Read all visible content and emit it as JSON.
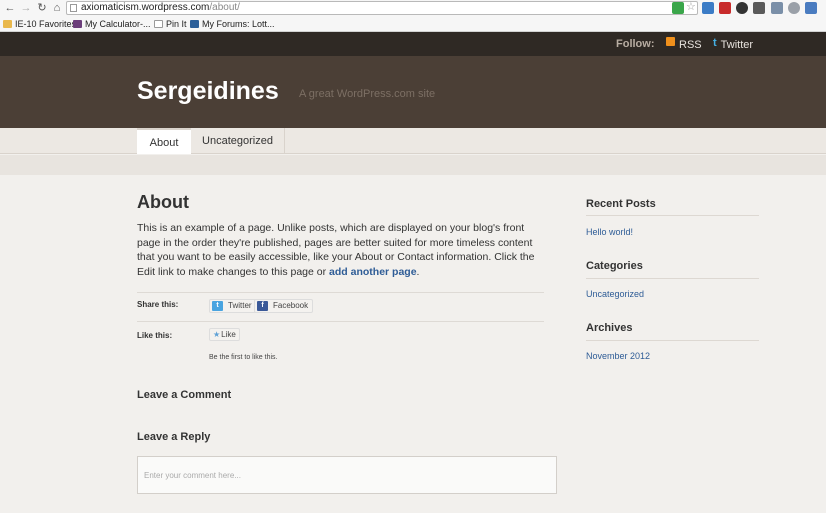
{
  "browser": {
    "url_domain": "axiomaticism.wordpress.com",
    "url_path": "/about/",
    "bookmarks": [
      {
        "label": "IE-10 Favorites",
        "icon": "folder-icon",
        "color": "#e9b84c"
      },
      {
        "label": "My Calculator-...",
        "icon": "calculator-icon",
        "color": "#6b3d7a"
      },
      {
        "label": "Pin It",
        "icon": "page-icon",
        "color": "#ffffff"
      },
      {
        "label": "My Forums: Lott...",
        "icon": "forum-icon",
        "color": "#2c5f99"
      }
    ]
  },
  "header": {
    "follow_label": "Follow:",
    "rss_label": "RSS",
    "twitter_label": "Twitter",
    "site_title": "Sergeidines",
    "tagline": "A great WordPress.com site"
  },
  "menu": {
    "items": [
      {
        "label": "About",
        "active": true
      },
      {
        "label": "Uncategorized",
        "active": false
      }
    ]
  },
  "post": {
    "title": "About",
    "body_text": "This is an example of a page. Unlike posts, which are displayed on your blog's front page in the order they're published, pages are better suited for more timeless content that you want to be easily accessible, like your About or Contact information. Click the Edit link to make changes to this page or ",
    "body_link": "add another page",
    "body_end": ".",
    "share_label": "Share this:",
    "share_twitter": "Twitter",
    "share_facebook": "Facebook",
    "like_label": "Like this:",
    "like_button": "Like",
    "first_like": "Be the first to like this.",
    "leave_comment": "Leave a Comment",
    "leave_reply": "Leave a Reply",
    "comment_placeholder": "Enter your comment here..."
  },
  "sidebar": {
    "recent_posts_title": "Recent Posts",
    "recent_posts": [
      "Hello world!"
    ],
    "categories_title": "Categories",
    "categories": [
      "Uncategorized"
    ],
    "archives_title": "Archives",
    "archives": [
      "November 2012"
    ]
  },
  "colors": {
    "topbar": "#2f2924",
    "masthead": "#4b3f36",
    "link": "#2e5c96",
    "rss": "#f0901c",
    "twitter": "#45b0e3"
  }
}
